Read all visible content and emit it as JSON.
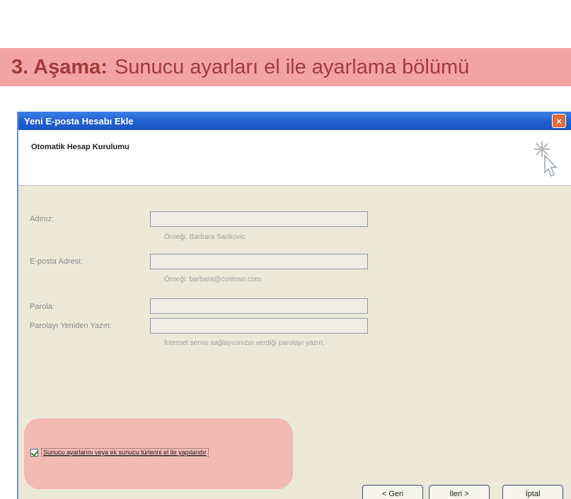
{
  "banner": {
    "step": "3. Aşama:",
    "text": "Sunucu ayarları el ile ayarlama bölümü"
  },
  "dialog": {
    "title": "Yeni E-posta Hesabı Ekle",
    "close_symbol": "×",
    "header_title": "Otomatik Hesap Kurulumu",
    "fields": {
      "name_label": "Adınız:",
      "name_hint": "Örneği: Barbara Sankovic",
      "name_value": "",
      "email_label": "E-posta Adresi:",
      "email_hint": "Örneği: barbara@contoso.com",
      "email_value": "",
      "password_label": "Parola:",
      "password_value": "",
      "password_retype_label": "Parolayı Yeniden Yazın:",
      "password_retype_value": "",
      "password_hint": "İnternet servis sağlayıcınızın verdiği parolayı yazın."
    },
    "manual_config_checkbox": {
      "label": "Sunucu ayarlarını veya ek sunucu türlerini el ile yapılandır",
      "checked": true
    },
    "buttons": {
      "back": "< Geri",
      "next": "İleri >",
      "cancel": "İptal"
    }
  },
  "colors": {
    "banner_bg": "#f3a3a5",
    "banner_text": "#a23b3b",
    "titlebar": "#1f5fd0",
    "dialog_bg": "#ece9d8",
    "highlight": "#f1b5b2"
  },
  "icons": [
    "wizard-cursor-icon",
    "close-icon",
    "checkbox-check-icon"
  ]
}
